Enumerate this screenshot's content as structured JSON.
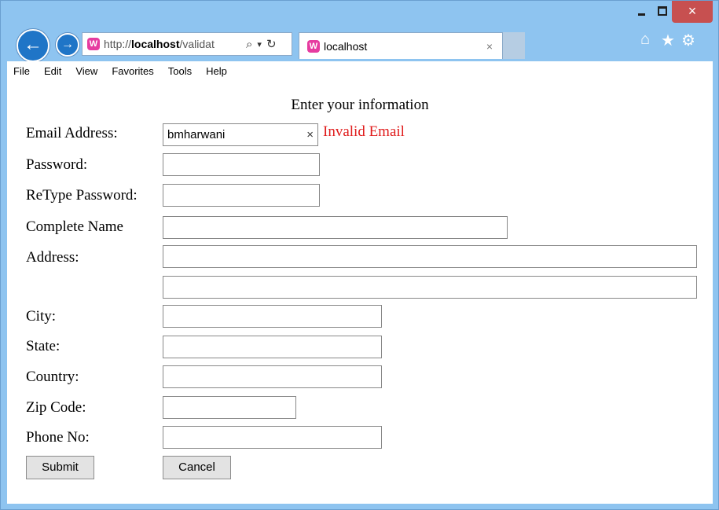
{
  "window": {
    "minimize_label": "",
    "close_label": "×"
  },
  "browser": {
    "url_prefix": "http://",
    "url_host": "localhost",
    "url_rest": "/validat",
    "search_glyph": "⌕",
    "dropdown_glyph": "▾",
    "refresh_glyph": "↻",
    "tab_title": "localhost",
    "tab_close": "×",
    "back_glyph": "←",
    "forward_glyph": "→",
    "home_glyph": "⌂",
    "favorites_glyph": "★",
    "tools_glyph": "⚙"
  },
  "menu": [
    "File",
    "Edit",
    "View",
    "Favorites",
    "Tools",
    "Help"
  ],
  "form": {
    "title": "Enter your information",
    "email_label": "Email Address:",
    "email_value": "bmharwani",
    "email_clear": "×",
    "email_error": "Invalid Email",
    "password_label": "Password:",
    "retype_label": "ReType Password:",
    "name_label": "Complete Name",
    "address_label": "Address:",
    "city_label": "City:",
    "state_label": "State:",
    "country_label": "Country:",
    "zip_label": "Zip Code:",
    "phone_label": "Phone No:",
    "submit_label": "Submit",
    "cancel_label": "Cancel"
  },
  "colors": {
    "error": "#e01b1b",
    "chrome": "#8ec4f0",
    "close": "#c75050"
  }
}
